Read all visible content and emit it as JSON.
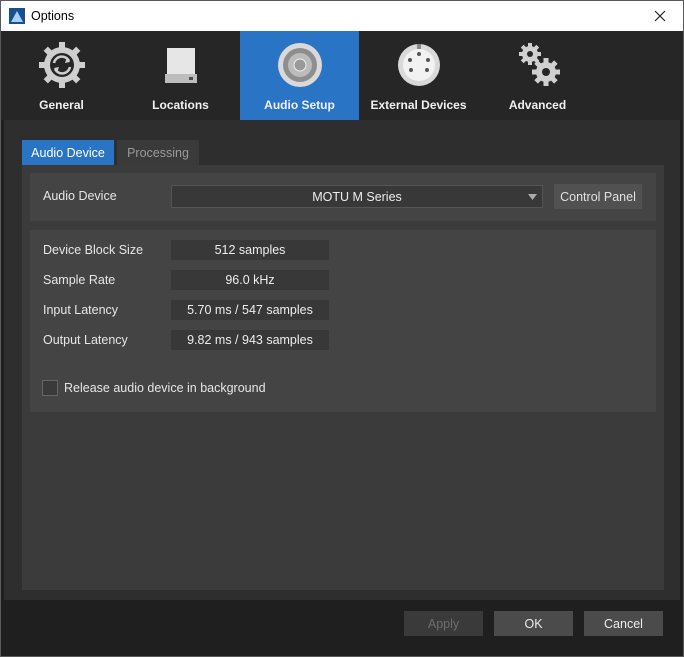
{
  "window": {
    "title": "Options"
  },
  "categories": [
    {
      "label": "General",
      "icon": "refresh-gear-icon"
    },
    {
      "label": "Locations",
      "icon": "drive-icon"
    },
    {
      "label": "Audio Setup",
      "icon": "speaker-icon",
      "active": true
    },
    {
      "label": "External Devices",
      "icon": "midi-port-icon"
    },
    {
      "label": "Advanced",
      "icon": "gears-icon"
    }
  ],
  "subtabs": {
    "audio_device": "Audio Device",
    "processing": "Processing"
  },
  "device": {
    "label": "Audio Device",
    "selected": "MOTU M Series",
    "control_panel": "Control Panel"
  },
  "info": [
    {
      "label": "Device Block Size",
      "value": "512 samples"
    },
    {
      "label": "Sample Rate",
      "value": "96.0 kHz"
    },
    {
      "label": "Input Latency",
      "value": "5.70 ms / 547 samples"
    },
    {
      "label": "Output Latency",
      "value": "9.82 ms / 943 samples"
    }
  ],
  "release_checkbox": {
    "label": "Release audio device in background",
    "checked": false
  },
  "buttons": {
    "apply": "Apply",
    "ok": "OK",
    "cancel": "Cancel"
  },
  "colors": {
    "accent": "#2a74c6",
    "background": "#2e2e2e"
  }
}
